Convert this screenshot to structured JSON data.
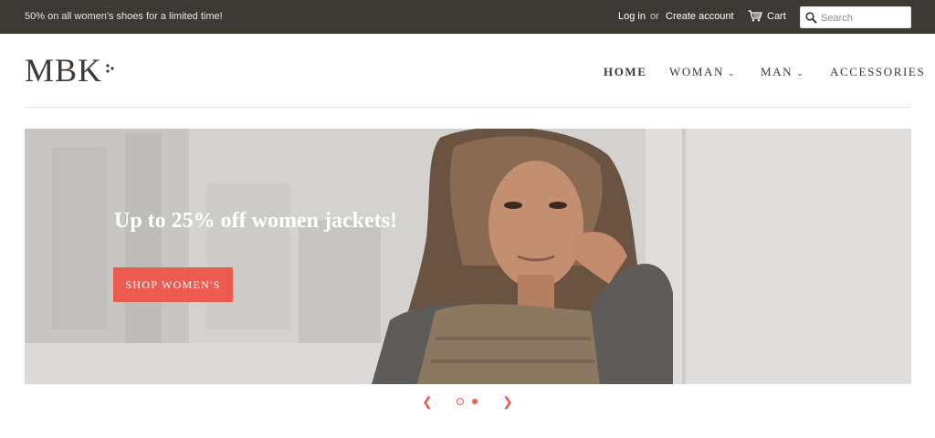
{
  "topbar": {
    "announcement": "50% on all women's shoes for a limited time!",
    "login": "Log in",
    "or": "or",
    "create_account": "Create account",
    "cart": "Cart",
    "search_placeholder": "Search"
  },
  "header": {
    "logo": "MBK",
    "nav": [
      {
        "label": "HOME",
        "active": true
      },
      {
        "label": "WOMAN",
        "dropdown": true
      },
      {
        "label": "MAN",
        "dropdown": true
      },
      {
        "label": "ACCESSORIES"
      }
    ]
  },
  "hero": {
    "headline": "Up to 25% off women jackets!",
    "cta": "SHOP WOMEN'S",
    "slides_total": 2,
    "active_slide": 1
  },
  "icons": {
    "cart": "cart-icon",
    "search": "search-icon",
    "prev": "chevron-left-icon",
    "next": "chevron-right-icon",
    "dropdown": "chevron-down-icon"
  },
  "colors": {
    "topbar_bg": "#3d3935",
    "accent": "#ec5b4f",
    "text": "#3d3935"
  }
}
